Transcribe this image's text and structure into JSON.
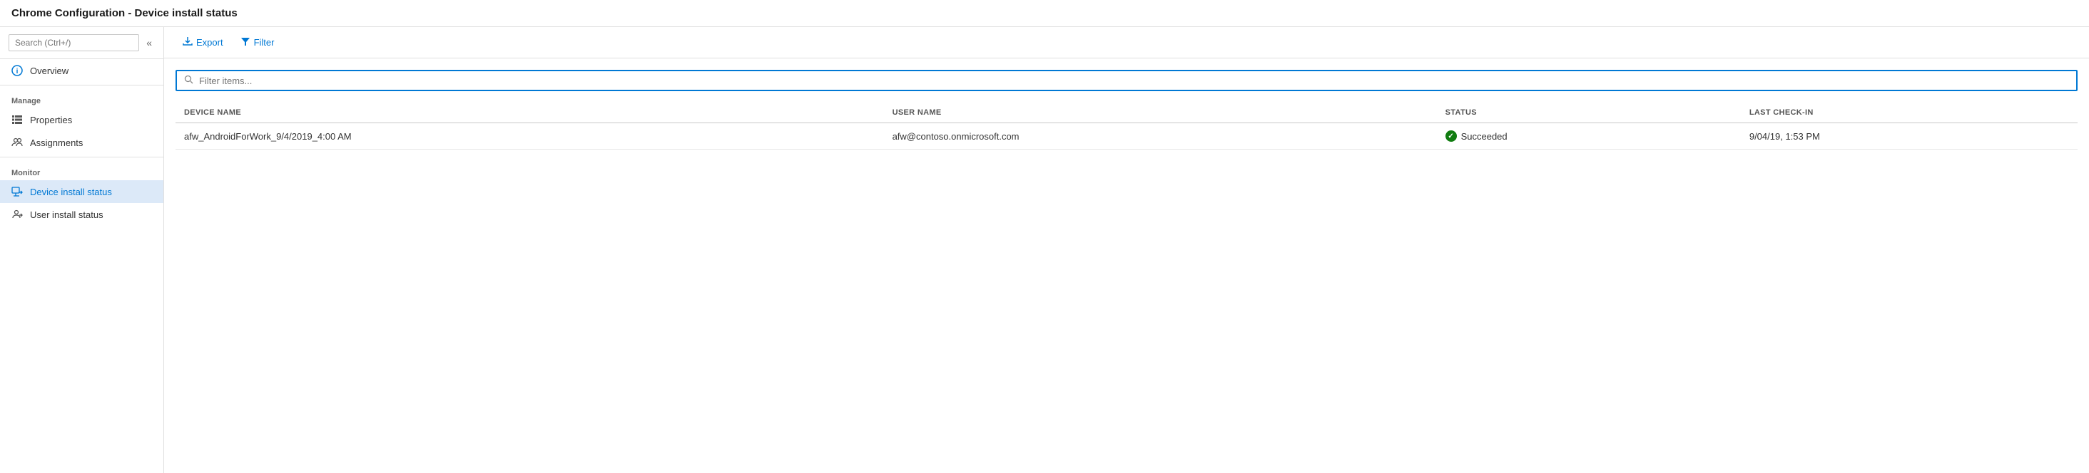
{
  "title": "Chrome Configuration - Device install status",
  "sidebar": {
    "search_placeholder": "Search (Ctrl+/)",
    "collapse_icon": "«",
    "sections": [
      {
        "label": "",
        "items": [
          {
            "id": "overview",
            "label": "Overview",
            "icon": "info",
            "active": false
          }
        ]
      },
      {
        "label": "Manage",
        "items": [
          {
            "id": "properties",
            "label": "Properties",
            "icon": "properties",
            "active": false
          },
          {
            "id": "assignments",
            "label": "Assignments",
            "icon": "assignments",
            "active": false
          }
        ]
      },
      {
        "label": "Monitor",
        "items": [
          {
            "id": "device-install-status",
            "label": "Device install status",
            "icon": "device",
            "active": true
          },
          {
            "id": "user-install-status",
            "label": "User install status",
            "icon": "user",
            "active": false
          }
        ]
      }
    ]
  },
  "toolbar": {
    "export_label": "Export",
    "filter_label": "Filter"
  },
  "filter_placeholder": "Filter items...",
  "table": {
    "columns": [
      "DEVICE NAME",
      "USER NAME",
      "STATUS",
      "LAST CHECK-IN"
    ],
    "rows": [
      {
        "device_name": "afw_AndroidForWork_9/4/2019_4:00 AM",
        "user_name": "afw@contoso.onmicrosoft.com",
        "status": "Succeeded",
        "status_type": "success",
        "last_checkin": "9/04/19, 1:53 PM"
      }
    ]
  },
  "colors": {
    "accent": "#0078d4",
    "success": "#107c10",
    "active_bg": "#dce9f8"
  }
}
